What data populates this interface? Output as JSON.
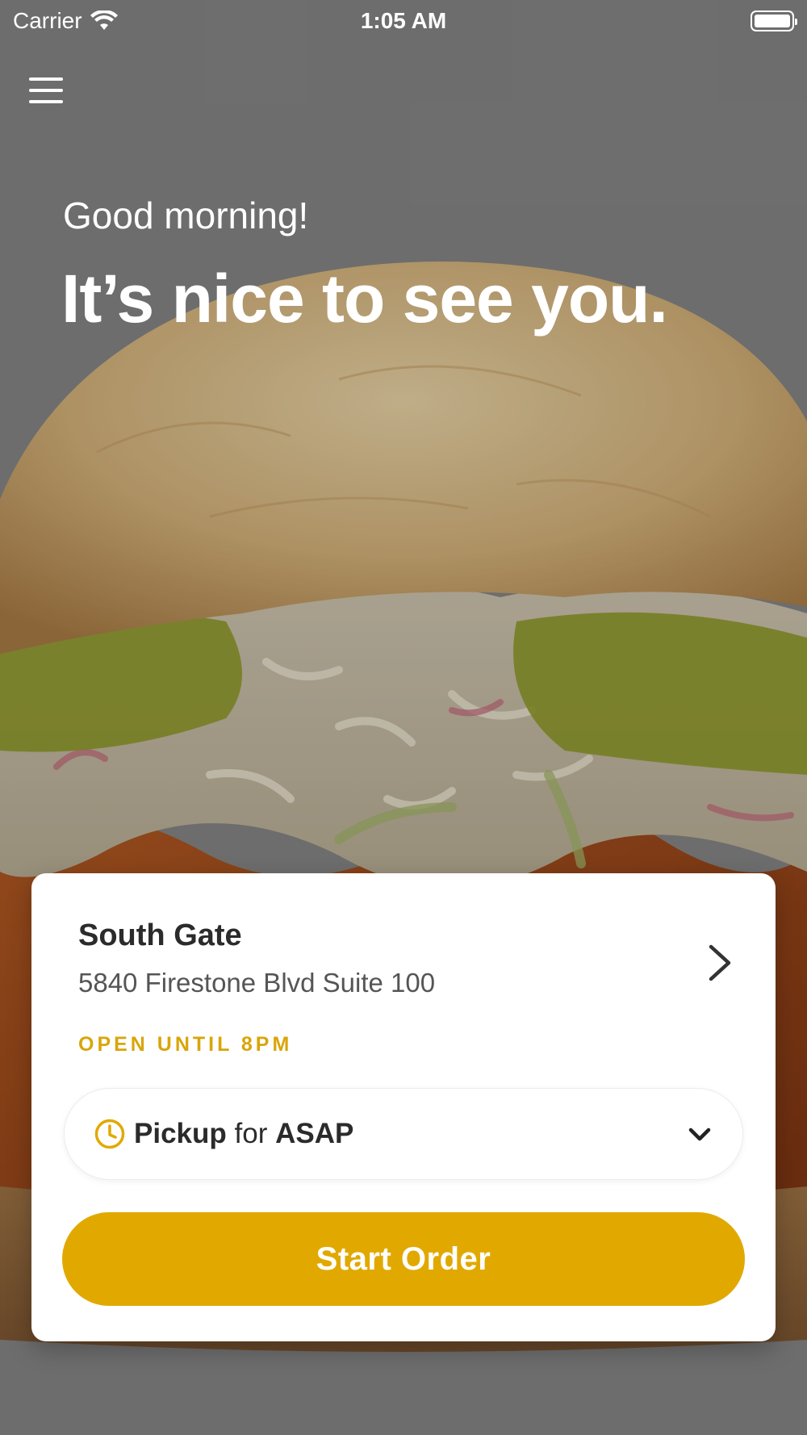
{
  "status_bar": {
    "carrier": "Carrier",
    "time": "1:05 AM"
  },
  "icons": {
    "menu": "hamburger-menu-icon",
    "wifi": "wifi-icon",
    "battery": "battery-icon",
    "chevron_right": "chevron-right-icon",
    "clock": "clock-icon",
    "chevron_down": "chevron-down-icon"
  },
  "greeting": {
    "subtitle": "Good morning!",
    "title": "It’s nice to see you."
  },
  "store": {
    "name": "South Gate",
    "address": "5840 Firestone Blvd Suite 100",
    "hours": "OPEN UNTIL 8PM"
  },
  "order": {
    "mode": "Pickup",
    "connector": "for",
    "time": "ASAP",
    "start_label": "Start Order"
  },
  "colors": {
    "accent": "#e1a900",
    "hours_text": "#d9a50a",
    "background": "#868686"
  }
}
